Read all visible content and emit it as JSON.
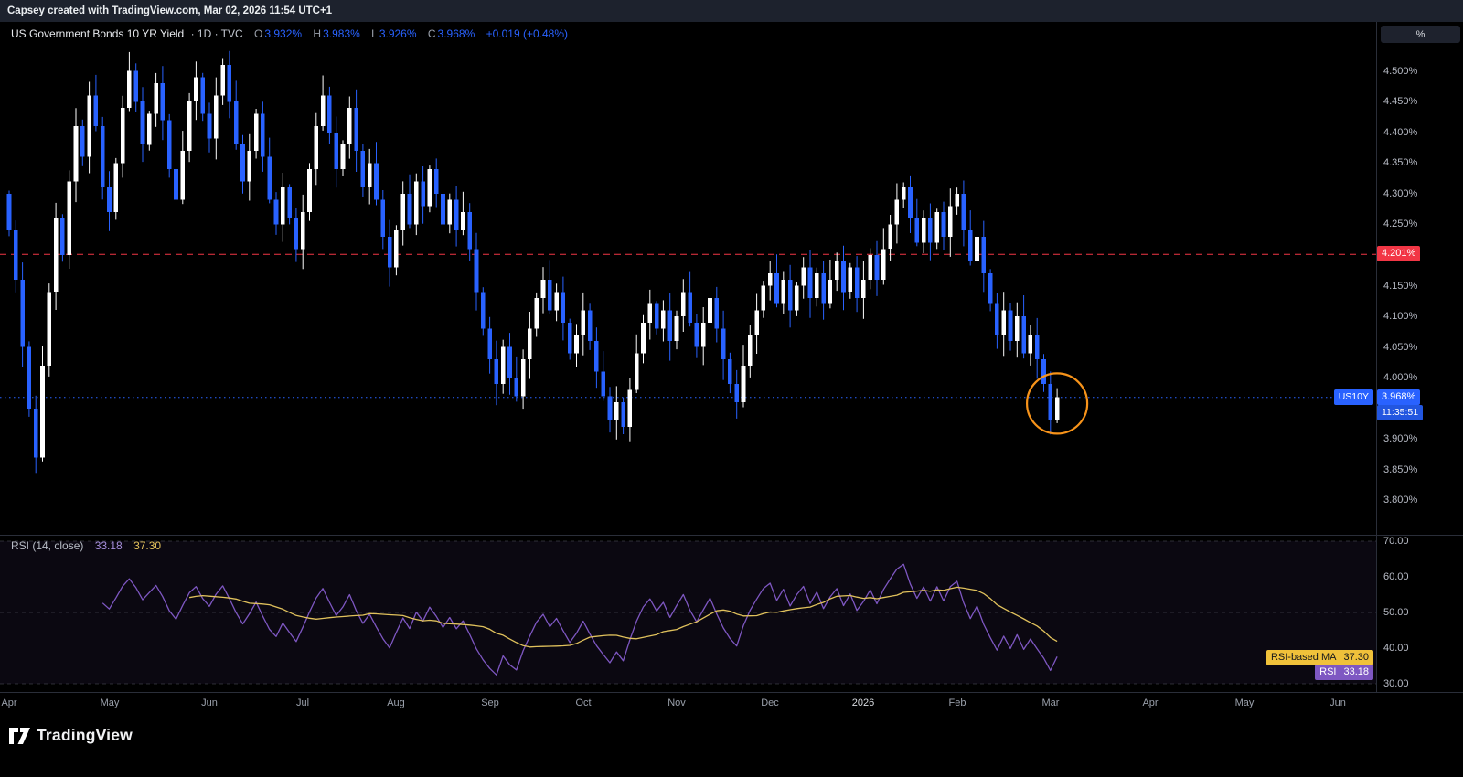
{
  "attribution_bar": {
    "text": "Capsey created with TradingView.com, Mar 02, 2026 11:54 UTC+1"
  },
  "main_chart": {
    "legend": {
      "title": "US Government Bonds 10 YR Yield",
      "interval_exchange": "· 1D · TVC",
      "o_label": "O",
      "o_value": "3.932%",
      "h_label": "H",
      "h_value": "3.983%",
      "l_label": "L",
      "l_value": "3.926%",
      "c_label": "C",
      "c_value": "3.968%",
      "change": "+0.019 (+0.48%)"
    },
    "price_axis": {
      "unit_button_label": "%",
      "ticks": [
        {
          "v": 4.5,
          "label": "4.500%"
        },
        {
          "v": 4.45,
          "label": "4.450%"
        },
        {
          "v": 4.4,
          "label": "4.400%"
        },
        {
          "v": 4.35,
          "label": "4.350%"
        },
        {
          "v": 4.3,
          "label": "4.300%"
        },
        {
          "v": 4.25,
          "label": "4.250%"
        },
        {
          "v": 4.15,
          "label": "4.150%"
        },
        {
          "v": 4.1,
          "label": "4.100%"
        },
        {
          "v": 4.05,
          "label": "4.050%"
        },
        {
          "v": 4.0,
          "label": "4.000%"
        },
        {
          "v": 3.9,
          "label": "3.900%"
        },
        {
          "v": 3.85,
          "label": "3.850%"
        },
        {
          "v": 3.8,
          "label": "3.800%"
        }
      ],
      "red_line": {
        "value": 4.201,
        "label": "4.201%",
        "color": "#f23645"
      },
      "current_price": {
        "symbol_chip": "US10Y",
        "label": "3.968%",
        "value": 3.968,
        "countdown": "11:35:51",
        "color": "#2962ff"
      }
    },
    "annotation_circle": {
      "candle_index": 157,
      "price": 3.958,
      "radius": 33,
      "color": "#f7931a"
    }
  },
  "rsi_pane": {
    "legend_title": "RSI (14, close)",
    "rsi_value": "33.18",
    "ma_value": "37.30",
    "ma_chip_label": "RSI-based MA",
    "rsi_chip_label": "RSI",
    "axis_ticks": [
      {
        "v": 70,
        "label": "70.00"
      },
      {
        "v": 60,
        "label": "60.00"
      },
      {
        "v": 50,
        "label": "50.00"
      },
      {
        "v": 40,
        "label": "40.00"
      },
      {
        "v": 30,
        "label": "30.00"
      }
    ],
    "colors": {
      "rsi": "#7e57c2",
      "ma": "#e0c15c",
      "band": "rgba(126,87,194,0.09)"
    }
  },
  "time_axis": {
    "months": [
      {
        "label": "Apr",
        "index": 0
      },
      {
        "label": "May",
        "index": 15
      },
      {
        "label": "Jun",
        "index": 30
      },
      {
        "label": "Jul",
        "index": 44
      },
      {
        "label": "Aug",
        "index": 58
      },
      {
        "label": "Sep",
        "index": 72
      },
      {
        "label": "Oct",
        "index": 86
      },
      {
        "label": "Nov",
        "index": 100
      },
      {
        "label": "Dec",
        "index": 114
      },
      {
        "label": "2026",
        "index": 128,
        "year": true
      },
      {
        "label": "Feb",
        "index": 142
      },
      {
        "label": "Mar",
        "index": 156
      },
      {
        "label": "Apr",
        "index": 171
      },
      {
        "label": "May",
        "index": 185
      },
      {
        "label": "Jun",
        "index": 199
      }
    ]
  },
  "footer": {
    "brand": "TradingView"
  },
  "chart_data": [
    {
      "type": "candlestick",
      "symbol": "US Government Bonds 10 YR Yield (US10Y)",
      "timeframe": "1D",
      "exchange": "TVC",
      "ylim": [
        3.744,
        4.58
      ],
      "yaxis_ticks": [
        4.5,
        4.45,
        4.4,
        4.35,
        4.3,
        4.25,
        4.201,
        4.15,
        4.1,
        4.05,
        4.0,
        3.968,
        3.9,
        3.85,
        3.8
      ],
      "first_open": 4.3,
      "closes": [
        4.24,
        4.16,
        4.05,
        3.95,
        3.87,
        4.02,
        4.14,
        4.26,
        4.2,
        4.32,
        4.41,
        4.36,
        4.46,
        4.41,
        4.31,
        4.27,
        4.35,
        4.44,
        4.5,
        4.45,
        4.38,
        4.43,
        4.48,
        4.42,
        4.34,
        4.29,
        4.37,
        4.45,
        4.49,
        4.43,
        4.39,
        4.46,
        4.51,
        4.45,
        4.38,
        4.32,
        4.37,
        4.43,
        4.36,
        4.29,
        4.25,
        4.31,
        4.26,
        4.21,
        4.27,
        4.34,
        4.41,
        4.46,
        4.4,
        4.34,
        4.38,
        4.44,
        4.37,
        4.31,
        4.35,
        4.29,
        4.23,
        4.18,
        4.24,
        4.3,
        4.25,
        4.32,
        4.28,
        4.34,
        4.3,
        4.25,
        4.29,
        4.24,
        4.27,
        4.21,
        4.14,
        4.08,
        4.03,
        3.99,
        4.05,
        4.0,
        3.97,
        4.03,
        4.08,
        4.13,
        4.16,
        4.11,
        4.14,
        4.09,
        4.04,
        4.07,
        4.11,
        4.06,
        4.01,
        3.97,
        3.93,
        3.96,
        3.92,
        3.98,
        4.04,
        4.09,
        4.12,
        4.08,
        4.11,
        4.06,
        4.1,
        4.14,
        4.09,
        4.05,
        4.09,
        4.13,
        4.08,
        4.03,
        3.99,
        3.96,
        4.02,
        4.07,
        4.11,
        4.15,
        4.17,
        4.12,
        4.16,
        4.11,
        4.15,
        4.18,
        4.13,
        4.17,
        4.12,
        4.16,
        4.19,
        4.14,
        4.18,
        4.13,
        4.16,
        4.2,
        4.16,
        4.21,
        4.25,
        4.29,
        4.31,
        4.26,
        4.22,
        4.26,
        4.22,
        4.27,
        4.23,
        4.28,
        4.3,
        4.24,
        4.19,
        4.23,
        4.17,
        4.12,
        4.07,
        4.11,
        4.06,
        4.1,
        4.04,
        4.07,
        4.03,
        3.99,
        3.932,
        3.968
      ],
      "last_candle": {
        "open": 3.932,
        "high": 3.983,
        "low": 3.926,
        "close": 3.968
      },
      "levels": [
        {
          "value": 4.201,
          "style": "dashed",
          "color": "#f23645"
        },
        {
          "value": 3.968,
          "style": "dotted",
          "color": "#2962ff"
        }
      ],
      "colors": {
        "up": "#ffffff",
        "down": "#2962ff"
      },
      "xlabel_months": [
        "Apr",
        "May",
        "Jun",
        "Jul",
        "Aug",
        "Sep",
        "Oct",
        "Nov",
        "Dec",
        "2026",
        "Feb",
        "Mar"
      ]
    },
    {
      "type": "line",
      "name": "RSI (14, close)",
      "series": [
        {
          "name": "RSI",
          "derived": "RSI(14) of candlestick closes",
          "last": 33.18
        },
        {
          "name": "RSI-based MA",
          "derived": "SMA(14) of RSI",
          "last": 37.3
        }
      ],
      "ylim": [
        27,
        72
      ],
      "yaxis_ticks": [
        70,
        60,
        50,
        40,
        30
      ],
      "levels": [
        70,
        50,
        30
      ],
      "legend_position": "top-left"
    }
  ]
}
